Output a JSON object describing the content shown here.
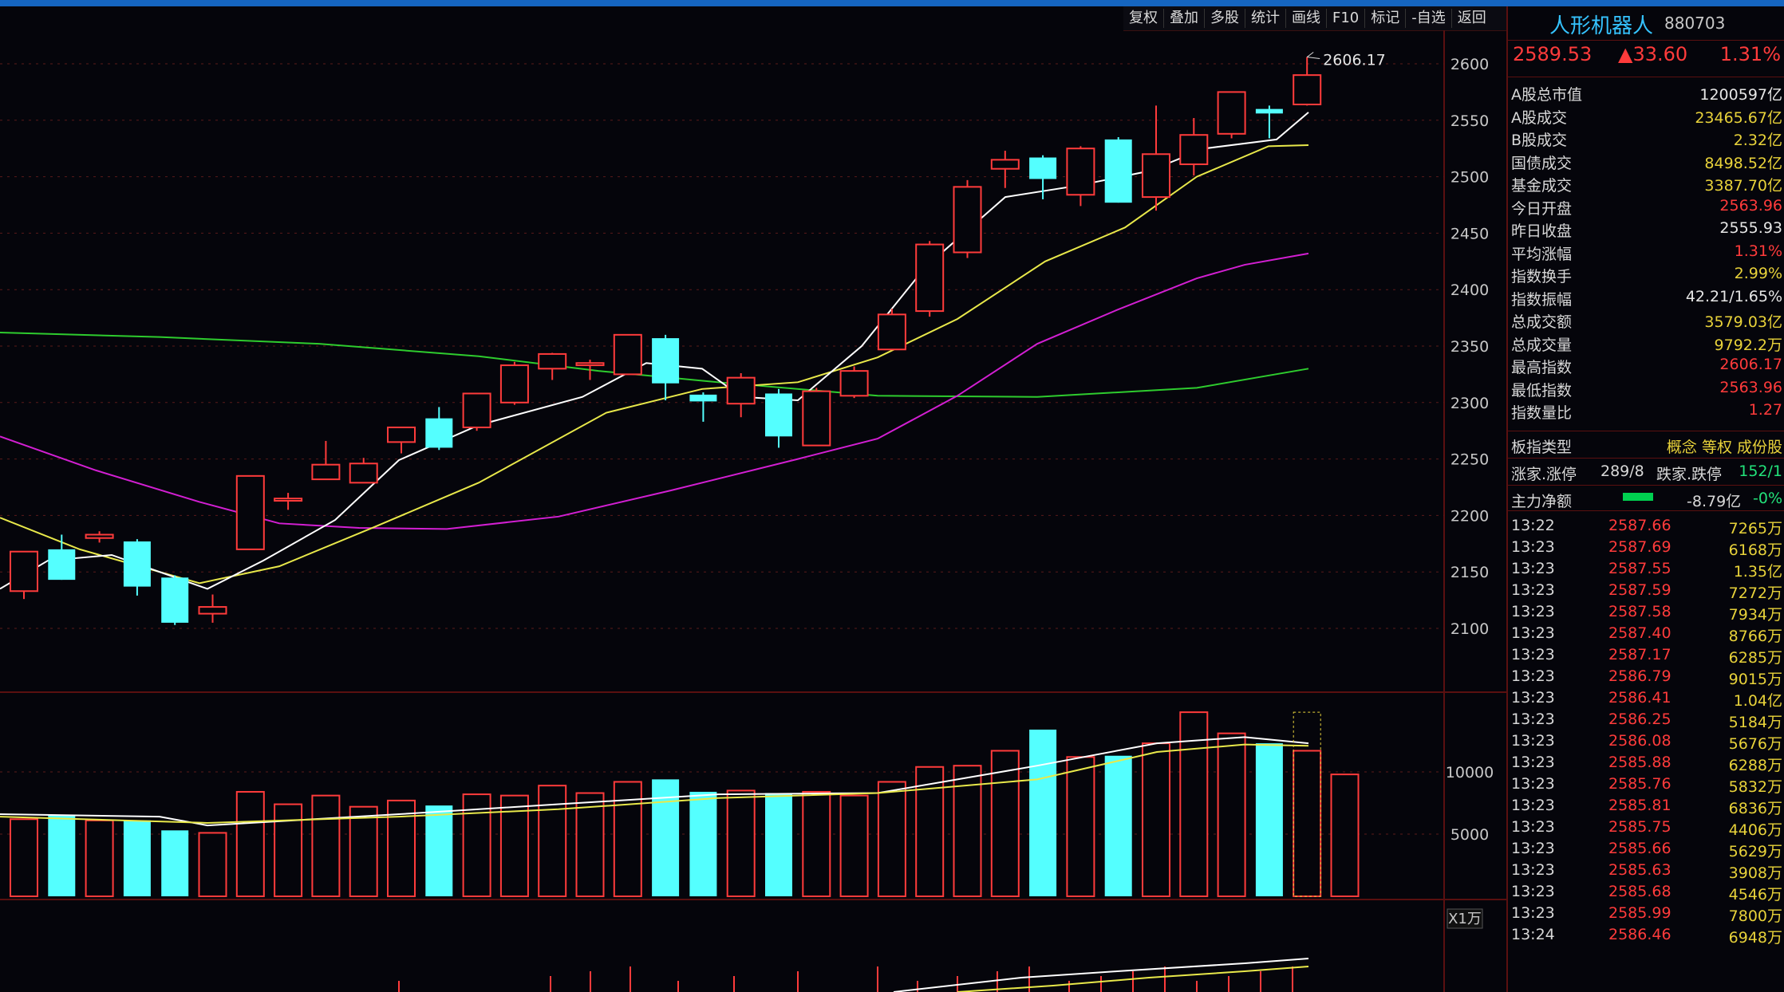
{
  "toolbar": {
    "items": [
      "复权",
      "叠加",
      "多股",
      "统计",
      "画线",
      "F10",
      "标记",
      "-自选",
      "返回"
    ]
  },
  "header": {
    "name": "人形机器人",
    "code": "880703",
    "price": "2589.53",
    "change": "▲33.60",
    "change_pct": "1.31%"
  },
  "stats": [
    {
      "k": "A股总市值",
      "v": "1200597亿",
      "c": "white"
    },
    {
      "k": "A股成交",
      "v": "23465.67亿",
      "c": "yel"
    },
    {
      "k": "B股成交",
      "v": "2.32亿",
      "c": "yel"
    },
    {
      "k": "国债成交",
      "v": "8498.52亿",
      "c": "yel"
    },
    {
      "k": "基金成交",
      "v": "3387.70亿",
      "c": "yel"
    },
    {
      "k": "今日开盘",
      "v": "2563.96",
      "c": "red"
    },
    {
      "k": "昨日收盘",
      "v": "2555.93",
      "c": "white"
    },
    {
      "k": "平均涨幅",
      "v": "1.31%",
      "c": "red"
    },
    {
      "k": "指数换手",
      "v": "2.99%",
      "c": "yel"
    },
    {
      "k": "指数振幅",
      "v": "42.21/1.65%",
      "c": "white"
    },
    {
      "k": "总成交额",
      "v": "3579.03亿",
      "c": "yel"
    },
    {
      "k": "总成交量",
      "v": "9792.2万",
      "c": "yel"
    },
    {
      "k": "最高指数",
      "v": "2606.17",
      "c": "red"
    },
    {
      "k": "最低指数",
      "v": "2563.96",
      "c": "red"
    },
    {
      "k": "指数量比",
      "v": "1.27",
      "c": "red"
    }
  ],
  "board": {
    "type_label": "板指类型",
    "type_value": "概念 等权 成份股",
    "updown_label": "涨家.涨停",
    "updown_value": "289/8",
    "down_label": "跌家.跌停",
    "down_value": "152/1",
    "main_label": "主力净额",
    "main_value": "-8.79亿",
    "main_pct": "-0%"
  },
  "ticks": [
    {
      "t": "13:22",
      "p": "2587.66",
      "v": "7265万"
    },
    {
      "t": "13:23",
      "p": "2587.69",
      "v": "6168万"
    },
    {
      "t": "13:23",
      "p": "2587.55",
      "v": "1.35亿"
    },
    {
      "t": "13:23",
      "p": "2587.59",
      "v": "7272万"
    },
    {
      "t": "13:23",
      "p": "2587.58",
      "v": "7934万"
    },
    {
      "t": "13:23",
      "p": "2587.40",
      "v": "8766万"
    },
    {
      "t": "13:23",
      "p": "2587.17",
      "v": "6285万"
    },
    {
      "t": "13:23",
      "p": "2586.79",
      "v": "9015万"
    },
    {
      "t": "13:23",
      "p": "2586.41",
      "v": "1.04亿"
    },
    {
      "t": "13:23",
      "p": "2586.25",
      "v": "5184万"
    },
    {
      "t": "13:23",
      "p": "2586.08",
      "v": "5676万"
    },
    {
      "t": "13:23",
      "p": "2585.88",
      "v": "6288万"
    },
    {
      "t": "13:23",
      "p": "2585.76",
      "v": "5832万"
    },
    {
      "t": "13:23",
      "p": "2585.81",
      "v": "6836万"
    },
    {
      "t": "13:23",
      "p": "2585.75",
      "v": "4406万"
    },
    {
      "t": "13:23",
      "p": "2585.66",
      "v": "5629万"
    },
    {
      "t": "13:23",
      "p": "2585.63",
      "v": "3908万"
    },
    {
      "t": "13:23",
      "p": "2585.68",
      "v": "4546万"
    },
    {
      "t": "13:23",
      "p": "2585.99",
      "v": "7800万"
    },
    {
      "t": "13:24",
      "p": "2586.46",
      "v": "6948万"
    }
  ],
  "chart_data": {
    "type": "candlestick",
    "price_axis": {
      "ticks": [
        2100,
        2150,
        2200,
        2250,
        2300,
        2350,
        2400,
        2450,
        2500,
        2550,
        2600
      ]
    },
    "high_label": "2606.17",
    "candles": [
      {
        "o": 2133,
        "c": 2168,
        "h": 2168,
        "l": 2126,
        "up": true
      },
      {
        "o": 2170,
        "c": 2143,
        "h": 2183,
        "l": 2143,
        "up": false
      },
      {
        "o": 2180,
        "c": 2183,
        "h": 2186,
        "l": 2176,
        "up": true
      },
      {
        "o": 2177,
        "c": 2137,
        "h": 2179,
        "l": 2129,
        "up": false
      },
      {
        "o": 2145,
        "c": 2105,
        "h": 2147,
        "l": 2103,
        "up": false
      },
      {
        "o": 2113,
        "c": 2119,
        "h": 2130,
        "l": 2105,
        "up": true
      },
      {
        "o": 2170,
        "c": 2235,
        "h": 2235,
        "l": 2170,
        "up": true
      },
      {
        "o": 2213,
        "c": 2215,
        "h": 2220,
        "l": 2205,
        "up": true
      },
      {
        "o": 2232,
        "c": 2245,
        "h": 2266,
        "l": 2232,
        "up": true
      },
      {
        "o": 2229,
        "c": 2246,
        "h": 2251,
        "l": 2229,
        "up": true
      },
      {
        "o": 2265,
        "c": 2278,
        "h": 2278,
        "l": 2255,
        "up": true
      },
      {
        "o": 2286,
        "c": 2260,
        "h": 2296,
        "l": 2258,
        "up": false
      },
      {
        "o": 2278,
        "c": 2308,
        "h": 2308,
        "l": 2275,
        "up": true
      },
      {
        "o": 2300,
        "c": 2333,
        "h": 2336,
        "l": 2298,
        "up": true
      },
      {
        "o": 2330,
        "c": 2343,
        "h": 2344,
        "l": 2320,
        "up": true
      },
      {
        "o": 2333,
        "c": 2335,
        "h": 2338,
        "l": 2320,
        "up": true
      },
      {
        "o": 2325,
        "c": 2360,
        "h": 2360,
        "l": 2325,
        "up": true
      },
      {
        "o": 2357,
        "c": 2317,
        "h": 2360,
        "l": 2302,
        "up": false
      },
      {
        "o": 2307,
        "c": 2301,
        "h": 2309,
        "l": 2283,
        "up": false
      },
      {
        "o": 2299,
        "c": 2322,
        "h": 2326,
        "l": 2287,
        "up": true
      },
      {
        "o": 2308,
        "c": 2270,
        "h": 2312,
        "l": 2260,
        "up": false
      },
      {
        "o": 2262,
        "c": 2310,
        "h": 2313,
        "l": 2262,
        "up": true
      },
      {
        "o": 2306,
        "c": 2328,
        "h": 2332,
        "l": 2304,
        "up": true
      },
      {
        "o": 2347,
        "c": 2378,
        "h": 2383,
        "l": 2347,
        "up": true
      },
      {
        "o": 2381,
        "c": 2440,
        "h": 2443,
        "l": 2376,
        "up": true
      },
      {
        "o": 2433,
        "c": 2491,
        "h": 2497,
        "l": 2428,
        "up": true
      },
      {
        "o": 2507,
        "c": 2515,
        "h": 2523,
        "l": 2490,
        "up": true
      },
      {
        "o": 2517,
        "c": 2498,
        "h": 2519,
        "l": 2480,
        "up": false
      },
      {
        "o": 2484,
        "c": 2525,
        "h": 2527,
        "l": 2474,
        "up": true
      },
      {
        "o": 2533,
        "c": 2477,
        "h": 2535,
        "l": 2477,
        "up": false
      },
      {
        "o": 2482,
        "c": 2520,
        "h": 2563,
        "l": 2470,
        "up": true
      },
      {
        "o": 2511,
        "c": 2537,
        "h": 2552,
        "l": 2501,
        "up": true
      },
      {
        "o": 2538,
        "c": 2575,
        "h": 2575,
        "l": 2534,
        "up": true
      },
      {
        "o": 2560,
        "c": 2556,
        "h": 2563,
        "l": 2534,
        "up": false
      },
      {
        "o": 2564,
        "c": 2590,
        "h": 2606,
        "l": 2563,
        "up": true
      }
    ],
    "vol_axis": {
      "ticks": [
        5000,
        10000
      ],
      "unit": "X1万",
      "max": 15000
    },
    "volumes": [
      6200,
      6500,
      6100,
      6100,
      5300,
      5100,
      8400,
      7400,
      8100,
      7200,
      7700,
      7300,
      8200,
      8100,
      8900,
      8300,
      9200,
      9400,
      8400,
      8500,
      8300,
      8400,
      8100,
      9200,
      10400,
      10500,
      11700,
      13400,
      11200,
      11300,
      12300,
      14800,
      13100,
      12300,
      11700,
      9800
    ]
  }
}
